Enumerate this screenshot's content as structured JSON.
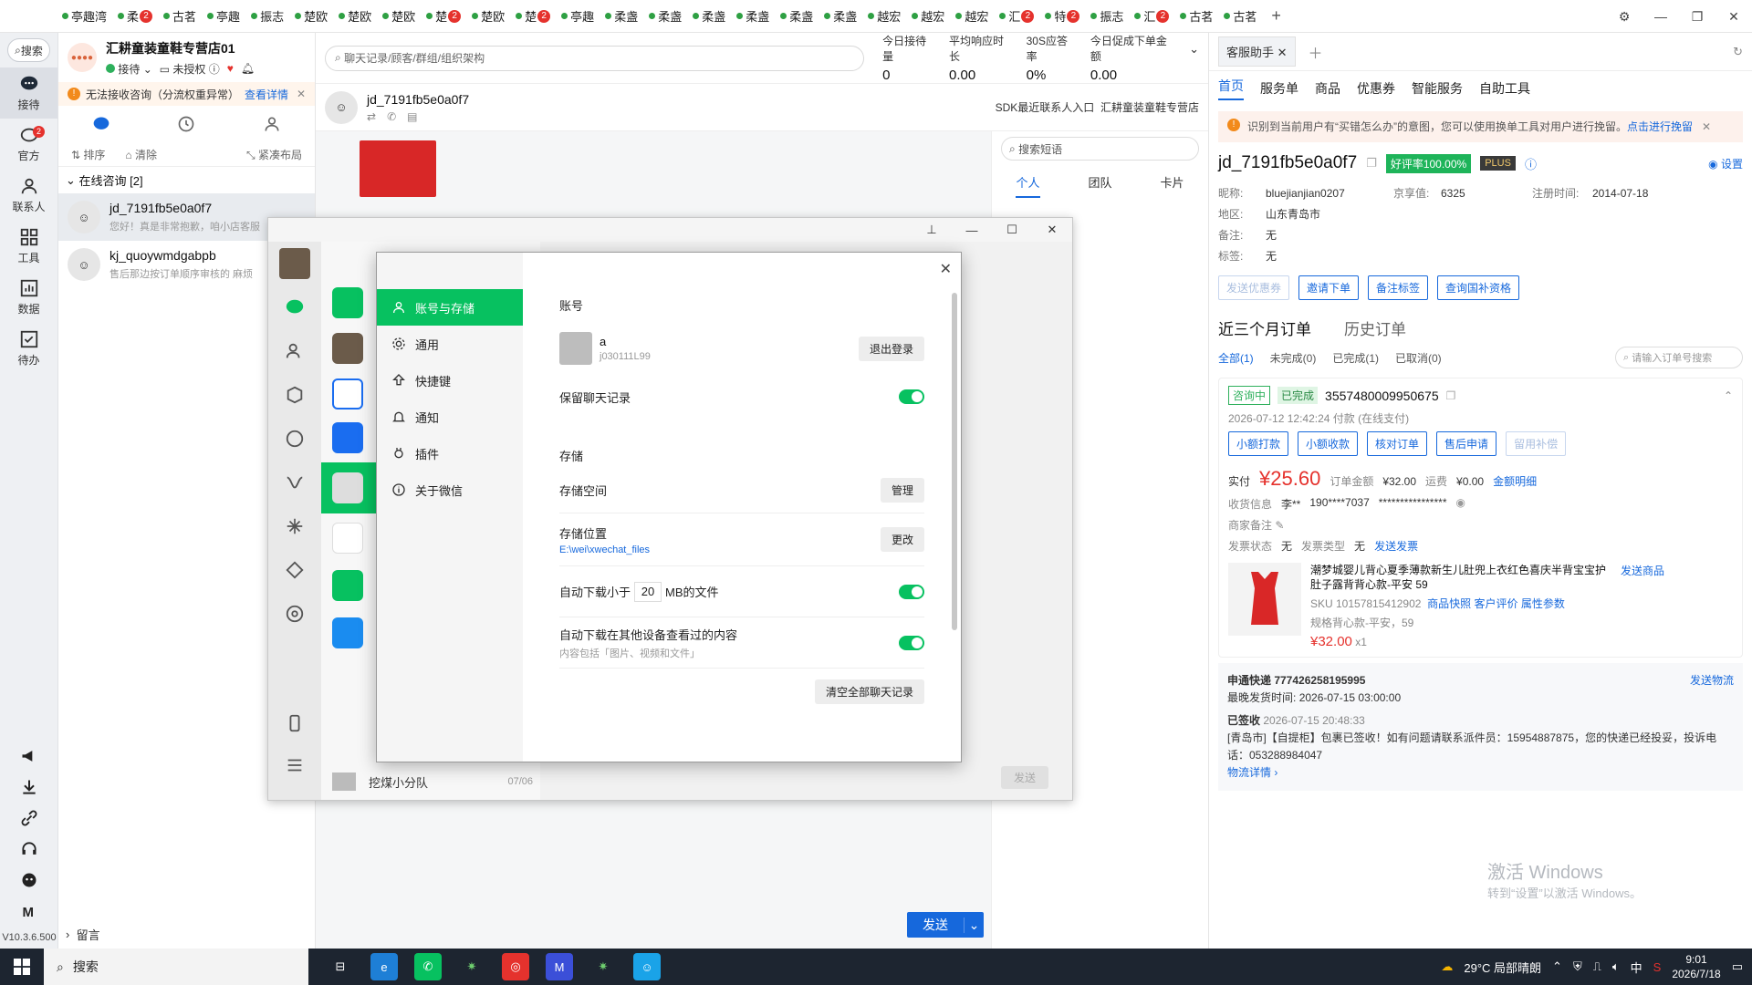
{
  "tabs": [
    {
      "label": "亭趣湾"
    },
    {
      "label": "柔",
      "badge": "2"
    },
    {
      "label": "古茗"
    },
    {
      "label": "亭趣"
    },
    {
      "label": "振志"
    },
    {
      "label": "楚欧"
    },
    {
      "label": "楚欧"
    },
    {
      "label": "楚欧"
    },
    {
      "label": "楚",
      "badge": "2"
    },
    {
      "label": "楚欧"
    },
    {
      "label": "楚",
      "badge": "2"
    },
    {
      "label": "亭趣"
    },
    {
      "label": "柔盏"
    },
    {
      "label": "柔盏"
    },
    {
      "label": "柔盏"
    },
    {
      "label": "柔盏"
    },
    {
      "label": "柔盏"
    },
    {
      "label": "柔盏"
    },
    {
      "label": "越宏"
    },
    {
      "label": "越宏"
    },
    {
      "label": "越宏"
    },
    {
      "label": "汇",
      "badge": "2"
    },
    {
      "label": "特",
      "badge": "2"
    },
    {
      "label": "振志"
    },
    {
      "label": "汇",
      "badge": "2"
    },
    {
      "label": "古茗"
    },
    {
      "label": "古茗"
    }
  ],
  "rail": {
    "search": "搜索",
    "items": [
      {
        "label": "接待",
        "icon": "chat-icon"
      },
      {
        "label": "官方",
        "icon": "message-icon",
        "badge": "2"
      },
      {
        "label": "联系人",
        "icon": "contact-icon"
      },
      {
        "label": "工具",
        "icon": "grid-icon"
      },
      {
        "label": "数据",
        "icon": "chart-icon"
      },
      {
        "label": "待办",
        "icon": "todo-icon"
      }
    ],
    "version": "V10.3.6.500"
  },
  "shop": {
    "name": "汇耕童装童鞋专营店01",
    "status": "接待",
    "auth": "未授权",
    "warning": "无法接收咨询（分流权重异常）",
    "warning_link": "查看详情"
  },
  "convtools": {
    "sort": "排序",
    "clear": "清除",
    "layout": "紧凑布局"
  },
  "section": "在线咨询 [2]",
  "conversations": [
    {
      "name": "jd_7191fb5e0a0f7",
      "msg": "您好！真是非常抱歉，咱小店客服"
    },
    {
      "name": "kj_quoywmdgabpb",
      "msg": "售后那边按订单顺序审核的 麻烦"
    }
  ],
  "leave": "留言",
  "chat": {
    "search_placeholder": "聊天记录/顾客/群组/组织架构",
    "kpis": [
      {
        "label": "今日接待量",
        "value": "0"
      },
      {
        "label": "平均响应时长",
        "value": "0.00"
      },
      {
        "label": "30S应答率",
        "value": "0%"
      },
      {
        "label": "今日促成下单金额",
        "value": "0.00"
      }
    ],
    "customer": "jd_7191fb5e0a0f7",
    "source": "SDK最近联系人入口",
    "shop": "汇耕童装童鞋专营店",
    "send": "发送",
    "phrase_search": "搜索短语",
    "phrase_tabs": [
      "个人",
      "团队",
      "卡片"
    ]
  },
  "right": {
    "tab": "客服助手",
    "nav": [
      "首页",
      "服务单",
      "商品",
      "优惠券",
      "智能服务",
      "自助工具"
    ],
    "notice": "识别到当前用户有“买错怎么办”的意图，您可以使用换单工具对用户进行挽留。",
    "notice_link": "点击进行挽留",
    "user": "jd_7191fb5e0a0f7",
    "rating": "好评率100.00%",
    "plus": "PLUS",
    "settings": "设置",
    "info": [
      {
        "k": "昵称:",
        "v": "bluejianjian0207",
        "k2": "京享值:",
        "v2": "6325",
        "k3": "注册时间:",
        "v3": "2014-07-18"
      },
      {
        "k": "地区:",
        "v": "山东青岛市"
      },
      {
        "k": "备注:",
        "v": "无"
      },
      {
        "k": "标签:",
        "v": "无"
      }
    ],
    "actions": [
      "发送优惠券",
      "邀请下单",
      "备注标签",
      "查询国补资格"
    ],
    "orders_title": "近三个月订单",
    "history_title": "历史订单",
    "filters": [
      "全部(1)",
      "未完成(0)",
      "已完成(1)",
      "已取消(0)"
    ],
    "order_search": "请输入订单号搜索",
    "order": {
      "consult": "咨询中",
      "status": "已完成",
      "id": "3557480009950675",
      "time": "2026-07-12 12:42:24 付款 (在线支付)",
      "ops": [
        "小额打款",
        "小额收款",
        "核对订单",
        "售后申请",
        "留用补偿"
      ],
      "paid_label": "实付",
      "paid": "¥25.60",
      "amount_label": "订单金额",
      "amount": "¥32.00",
      "freight_label": "运费",
      "freight": "¥0.00",
      "detail_link": "金额明细",
      "receiver_label": "收货信息",
      "receiver": "李**",
      "phone": "190****7037",
      "address": "****************",
      "merchant_note": "商家备注",
      "invoice_status_label": "发票状态",
      "invoice_status": "无",
      "invoice_type_label": "发票类型",
      "invoice_type": "无",
      "invoice_send": "发送发票",
      "product_title": "潮梦城婴儿背心夏季薄款新生儿肚兜上衣红色喜庆半背宝宝护肚子露背背心款-平安 59",
      "sku": "SKU 10157815412902",
      "snapshot": "商品快照",
      "review": "客户评价",
      "attrs": "属性参数",
      "spec": "规格背心款-平安，59",
      "price": "¥32.00",
      "qty": "x1",
      "send_product": "发送商品"
    },
    "logistics": {
      "carrier": "申通快递 777426258195995",
      "ship_time_label": "最晚发货时间:",
      "ship_time": "2026-07-15 03:00:00",
      "send_logistics": "发送物流",
      "signed": "已签收",
      "signed_time": "2026-07-15 20:48:33",
      "detail": "[青岛市]【自提柜】包裹已签收！如有问题请联系派件员：15954887875，您的快递已经投妥，投诉电话：053288984047",
      "detail_link": "物流详情"
    },
    "watermark1": "激活 Windows",
    "watermark2": "转到“设置”以激活 Windows。"
  },
  "wechat": {
    "list_item": "挖煤小分队",
    "list_date": "07/06",
    "send": "发送"
  },
  "settings": {
    "menu": [
      {
        "label": "账号与存储",
        "icon": "user-icon"
      },
      {
        "label": "通用",
        "icon": "gear-icon"
      },
      {
        "label": "快捷键",
        "icon": "shortcut-icon"
      },
      {
        "label": "通知",
        "icon": "bell-icon"
      },
      {
        "label": "插件",
        "icon": "plugin-icon"
      },
      {
        "label": "关于微信",
        "icon": "info-icon"
      }
    ],
    "account_header": "账号",
    "account_name": "a",
    "account_id": "j030111L99",
    "logout": "退出登录",
    "keep_history": "保留聊天记录",
    "storage_header": "存储",
    "storage_space": "存储空间",
    "manage": "管理",
    "storage_location": "存储位置",
    "storage_path": "E:\\wei\\xwechat_files",
    "change": "更改",
    "auto_download_prefix": "自动下载小于",
    "auto_download_size": "20",
    "auto_download_suffix": "MB的文件",
    "auto_download_other": "自动下载在其他设备查看过的内容",
    "auto_download_other_sub": "内容包括「图片、视频和文件」",
    "clear_all": "清空全部聊天记录"
  },
  "taskbar": {
    "search": "搜索",
    "weather": "29°C 局部晴朗",
    "ime": "中",
    "time": "9:01",
    "date": "2026/7/18"
  }
}
